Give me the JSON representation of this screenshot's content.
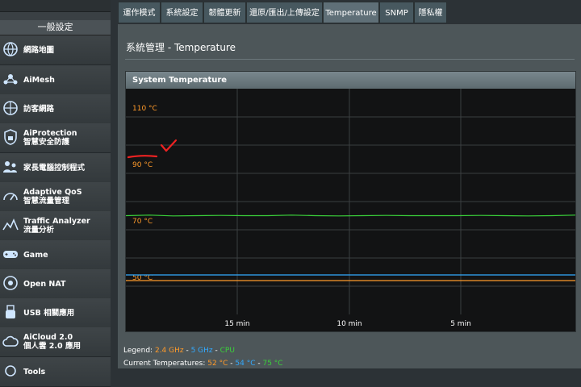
{
  "sidebar": {
    "section_title": "一般設定",
    "items": [
      {
        "label": "網路地圖",
        "icon": "globe-network-icon"
      },
      {
        "label": "AiMesh",
        "icon": "mesh-network-icon"
      },
      {
        "label": "訪客網路",
        "icon": "guest-globe-icon"
      },
      {
        "label": "AiProtection",
        "sublabel": "智慧安全防護",
        "icon": "shield-lock-icon"
      },
      {
        "label": "家長電腦控制程式",
        "icon": "family-users-icon"
      },
      {
        "label": "Adaptive QoS",
        "sublabel": "智慧流量管理",
        "icon": "speedometer-icon"
      },
      {
        "label": "Traffic Analyzer",
        "sublabel": "流量分析",
        "icon": "traffic-chart-icon"
      },
      {
        "label": "Game",
        "icon": "gamepad-icon"
      },
      {
        "label": "Open NAT",
        "icon": "open-nat-globe-icon"
      },
      {
        "label": "USB 相關應用",
        "icon": "usb-icon"
      },
      {
        "label": "AiCloud 2.0",
        "sublabel": "個人雲 2.0 應用",
        "icon": "cloud-icon"
      },
      {
        "label": "Tools",
        "icon": "tools-icon"
      }
    ]
  },
  "tabs": [
    "運作模式",
    "系統設定",
    "韌體更新",
    "還原/匯出/上傳設定",
    "Temperature",
    "SNMP",
    "隱私權"
  ],
  "active_tab": "Temperature",
  "page_title": "系統管理 - Temperature",
  "chart_data": {
    "type": "line",
    "title": "System Temperature",
    "y_tick_labels": [
      "110 °C",
      "90 °C",
      "70 °C",
      "50 °C"
    ],
    "x_tick_labels": [
      "15 min",
      "10 min",
      "5 min"
    ],
    "ylim": [
      40,
      120
    ],
    "series": [
      {
        "name": "2.4 GHz",
        "color": "#ff9a2a",
        "values": [
          52,
          52,
          52,
          52,
          52,
          52,
          52,
          52,
          52,
          52,
          52,
          52,
          52,
          52,
          52,
          52,
          52,
          52,
          52,
          52
        ]
      },
      {
        "name": "5 GHz",
        "color": "#32aaff",
        "values": [
          54,
          54,
          54,
          54,
          54,
          54,
          54,
          54,
          54,
          54,
          54,
          54,
          54,
          54,
          54,
          54,
          54,
          54,
          54,
          54
        ]
      },
      {
        "name": "CPU",
        "color": "#3ad13a",
        "values": [
          75,
          75.2,
          74.9,
          75,
          75.1,
          75,
          75,
          75.2,
          75,
          74.9,
          75,
          75.1,
          75,
          75,
          75,
          75.1,
          75,
          74.9,
          75,
          75.2
        ]
      }
    ]
  },
  "legend": {
    "label": "Legend:",
    "sep": " - "
  },
  "current": {
    "label": "Current Temperatures:",
    "v24": "52 °C",
    "v5": "54 °C",
    "vcpu": "75 °C",
    "sep": " - "
  }
}
